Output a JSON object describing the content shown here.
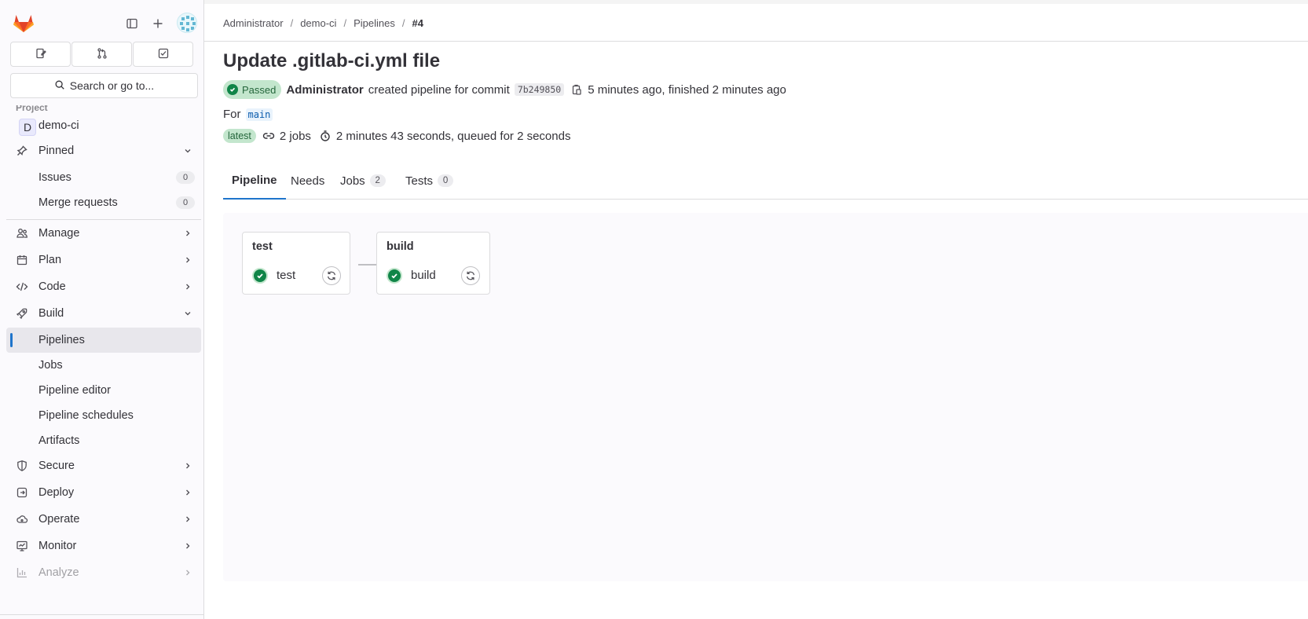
{
  "sidebar": {
    "search_placeholder": "Search or go to...",
    "section_label": "Project",
    "project": {
      "initial": "D",
      "name": "demo-ci"
    },
    "pinned": {
      "label": "Pinned",
      "items": [
        {
          "label": "Issues",
          "count": "0"
        },
        {
          "label": "Merge requests",
          "count": "0"
        }
      ]
    },
    "items": [
      {
        "label": "Manage",
        "icon": "users-icon"
      },
      {
        "label": "Plan",
        "icon": "calendar-icon"
      },
      {
        "label": "Code",
        "icon": "code-icon"
      },
      {
        "label": "Build",
        "icon": "rocket-icon"
      }
    ],
    "build_sub": [
      {
        "label": "Pipelines",
        "active": true
      },
      {
        "label": "Jobs"
      },
      {
        "label": "Pipeline editor"
      },
      {
        "label": "Pipeline schedules"
      },
      {
        "label": "Artifacts"
      }
    ],
    "bottom_items": [
      {
        "label": "Secure",
        "icon": "shield-icon"
      },
      {
        "label": "Deploy",
        "icon": "deploy-icon"
      },
      {
        "label": "Operate",
        "icon": "cloud-icon"
      },
      {
        "label": "Monitor",
        "icon": "monitor-icon"
      },
      {
        "label": "Analyze",
        "icon": "chart-icon"
      }
    ]
  },
  "breadcrumb": [
    "Administrator",
    "demo-ci",
    "Pipelines",
    "#4"
  ],
  "pipeline": {
    "title": "Update .gitlab-ci.yml file",
    "status": "Passed",
    "author": "Administrator",
    "action_text": "created pipeline for commit",
    "sha": "7b249850",
    "timing": "5 minutes ago, finished 2 minutes ago",
    "for_label": "For",
    "ref": "main",
    "latest_badge": "latest",
    "jobs_text": "2 jobs",
    "duration_text": "2 minutes 43 seconds, queued for 2 seconds"
  },
  "tabs": [
    {
      "label": "Pipeline"
    },
    {
      "label": "Needs"
    },
    {
      "label": "Jobs",
      "count": "2"
    },
    {
      "label": "Tests",
      "count": "0"
    }
  ],
  "stages": [
    {
      "title": "test",
      "job": "test"
    },
    {
      "title": "build",
      "job": "build"
    }
  ],
  "colors": {
    "success": "#108548",
    "active_tab": "#1f75cb",
    "sidebar_bg": "#fbfafd"
  }
}
